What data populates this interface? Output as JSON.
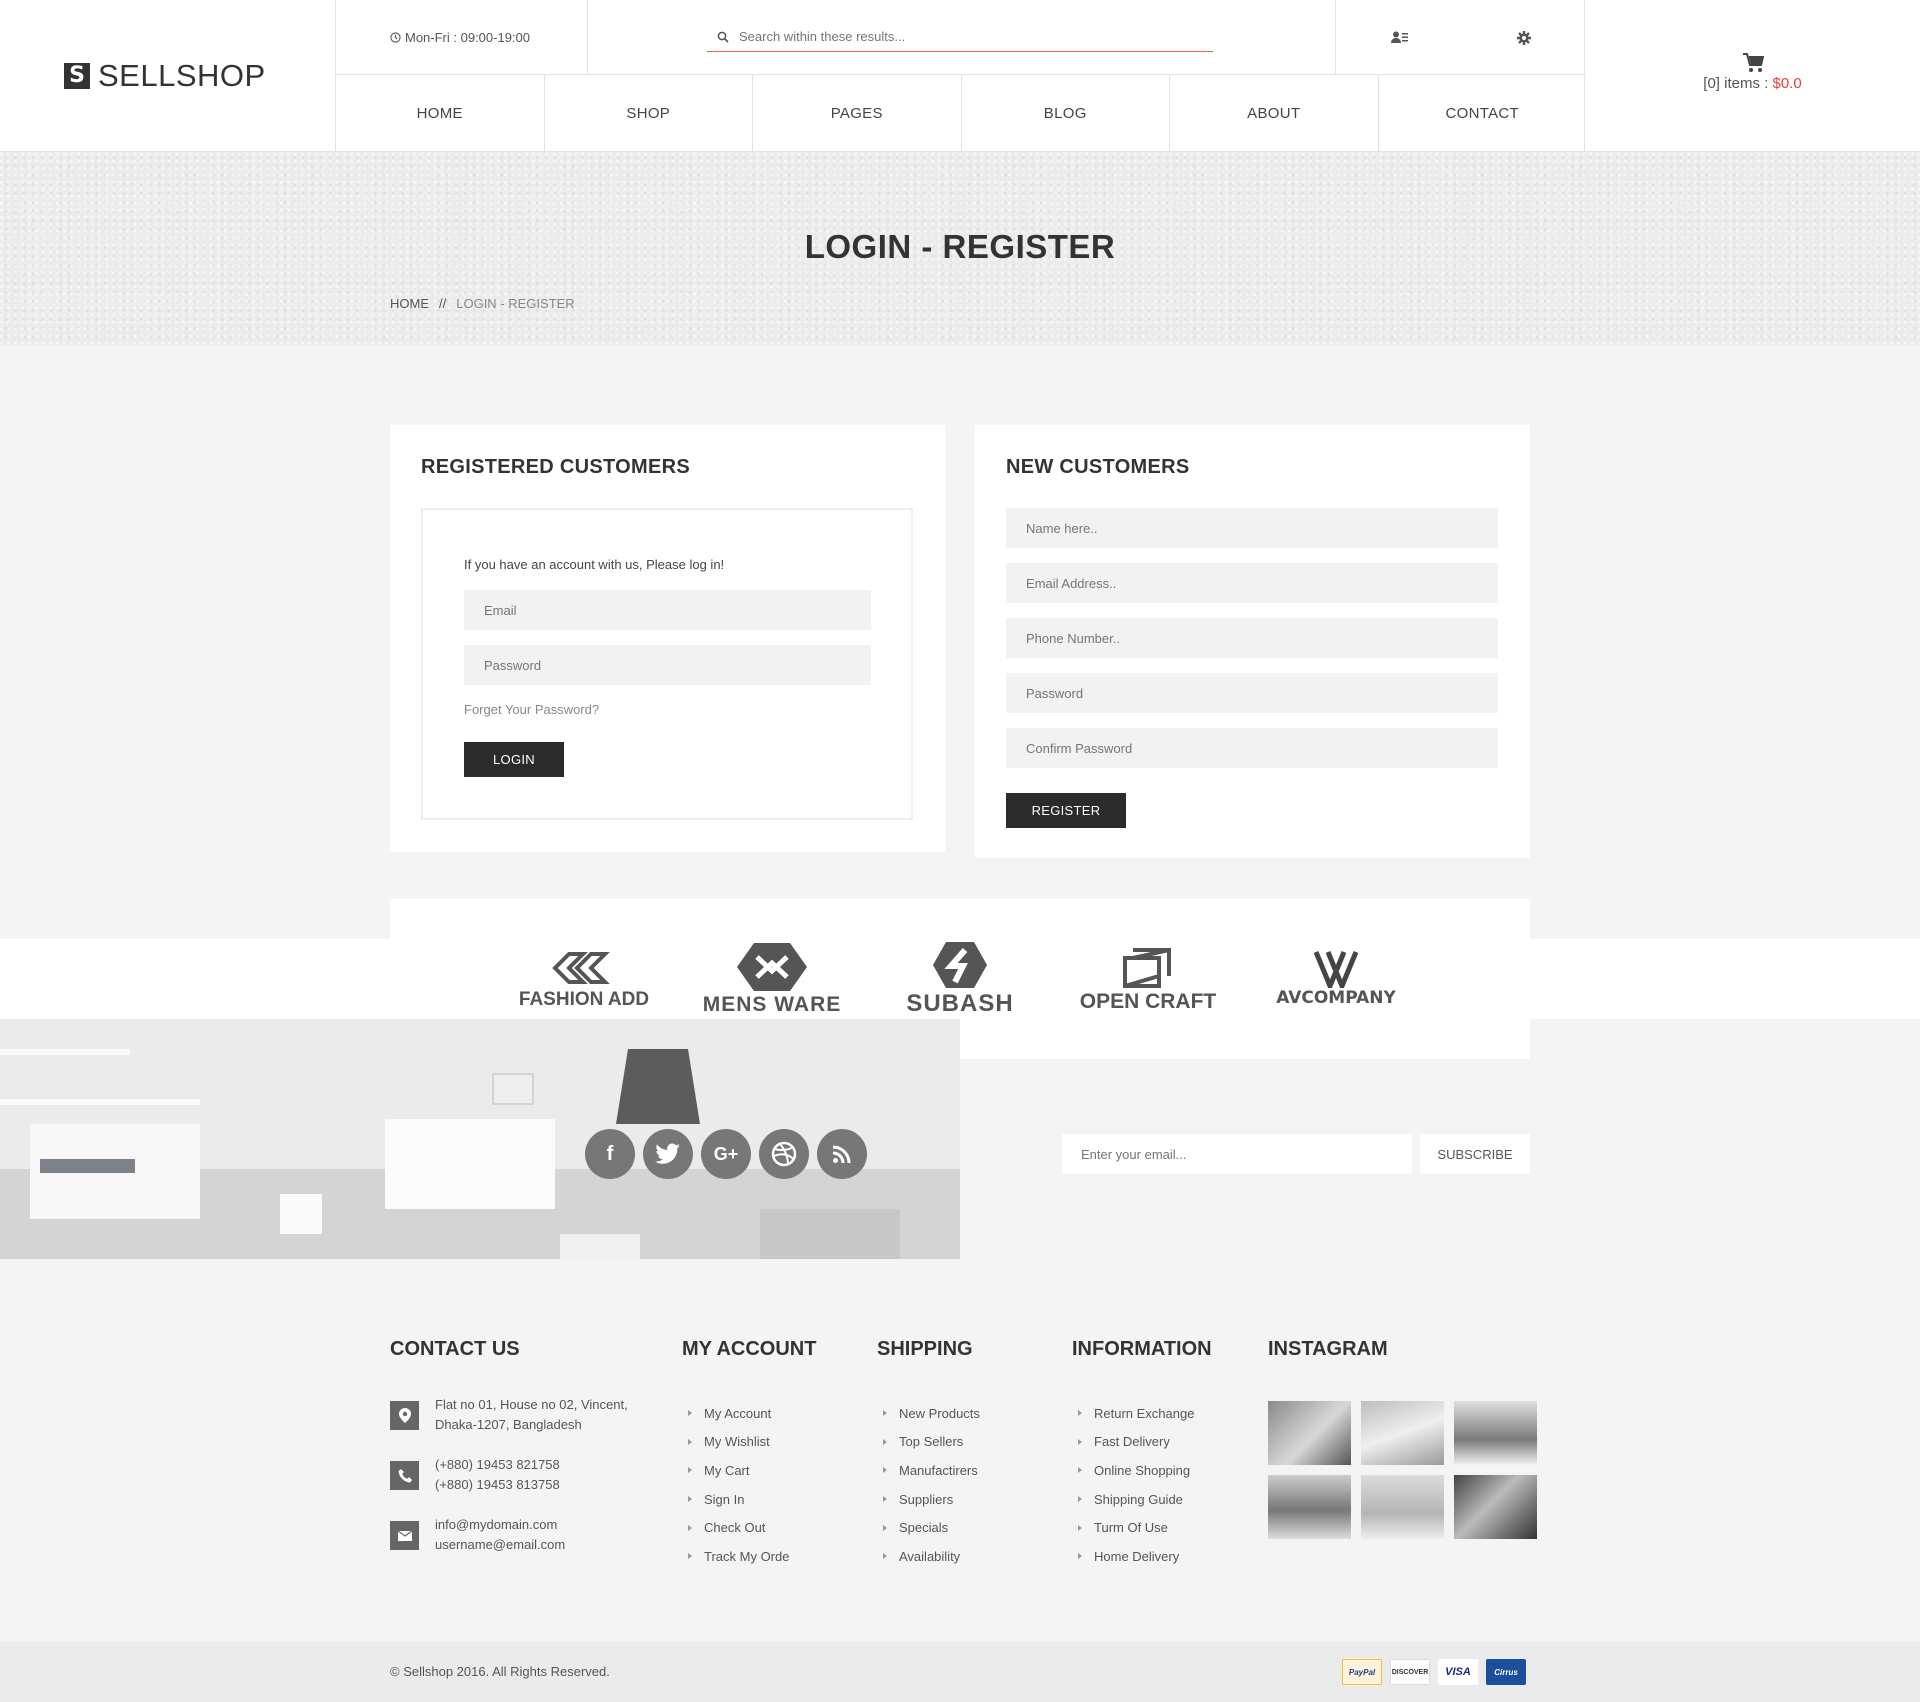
{
  "header": {
    "logo_mark": "S",
    "logo_text": "SELLSHOP",
    "hours": "Mon-Fri : 09:00-19:00",
    "search_placeholder": "Search within these results...",
    "nav": [
      "HOME",
      "SHOP",
      "PAGES",
      "BLOG",
      "ABOUT",
      "CONTACT"
    ],
    "cart_items": "[0] items :",
    "cart_total": "$0.0"
  },
  "hero": {
    "title": "LOGIN - REGISTER",
    "breadcrumb_home": "HOME",
    "breadcrumb_sep": "//",
    "breadcrumb_current": "LOGIN - REGISTER"
  },
  "login": {
    "title": "REGISTERED CUSTOMERS",
    "intro": "If you have an account with us, Please log in!",
    "email_placeholder": "Email",
    "password_placeholder": "Password",
    "forgot": "Forget Your Password?",
    "button": "LOGIN"
  },
  "register": {
    "title": "NEW CUSTOMERS",
    "name_placeholder": "Name here..",
    "email_placeholder": "Email Address..",
    "phone_placeholder": "Phone Number..",
    "password_placeholder": "Password",
    "confirm_placeholder": "Confirm Password",
    "button": "REGISTER"
  },
  "brands": [
    "FASHION ADD",
    "MENS WARE",
    "SUBASH",
    "OPEN CRAFT",
    "AVCOMPANY"
  ],
  "social": [
    "f",
    "t",
    "G+",
    "dribbble",
    "rss"
  ],
  "subscribe": {
    "placeholder": "Enter your email...",
    "button": "SUBSCRIBE"
  },
  "footer": {
    "contact_title": "CONTACT US",
    "address_1": "Flat no 01, House no 02, Vincent,",
    "address_2": "Dhaka-1207, Bangladesh",
    "phone_1": "(+880) 19453 821758",
    "phone_2": "(+880) 19453 813758",
    "email_1": "info@mydomain.com",
    "email_2": "username@email.com",
    "account_title": "MY ACCOUNT",
    "account_links": [
      "My Account",
      "My Wishlist",
      "My Cart",
      "Sign In",
      "Check Out",
      "Track My Orde"
    ],
    "shipping_title": "SHIPPING",
    "shipping_links": [
      "New Products",
      "Top Sellers",
      "Manufactirers",
      "Suppliers",
      "Specials",
      "Availability"
    ],
    "info_title": "INFORMATION",
    "info_links": [
      "Return Exchange",
      "Fast Delivery",
      "Online Shopping",
      "Shipping Guide",
      "Turm Of Use",
      "Home Delivery"
    ],
    "instagram_title": "INSTAGRAM",
    "copyright": "© Sellshop 2016. All Rights Reserved.",
    "payments": [
      "PayPal",
      "DISCOVER",
      "VISA",
      "Cirrus"
    ]
  },
  "colors": {
    "accent": "#e93b3b",
    "dark_button": "#2b2b2b",
    "page_bg": "#f4f4f4"
  }
}
